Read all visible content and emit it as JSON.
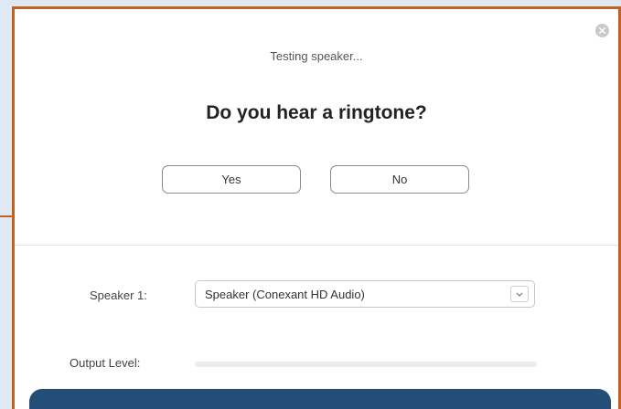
{
  "dialog": {
    "status_text": "Testing speaker...",
    "question": "Do you hear a ringtone?",
    "yes_label": "Yes",
    "no_label": "No",
    "close_icon": "close-icon"
  },
  "speaker": {
    "label": "Speaker 1:",
    "selected": "Speaker (Conexant HD Audio)",
    "chevron_icon": "chevron-down-icon"
  },
  "output": {
    "label": "Output Level:",
    "level_percent": 0
  },
  "colors": {
    "frame_border": "#c2621e",
    "banner": "#244e78",
    "accent": "#2d8cff"
  }
}
